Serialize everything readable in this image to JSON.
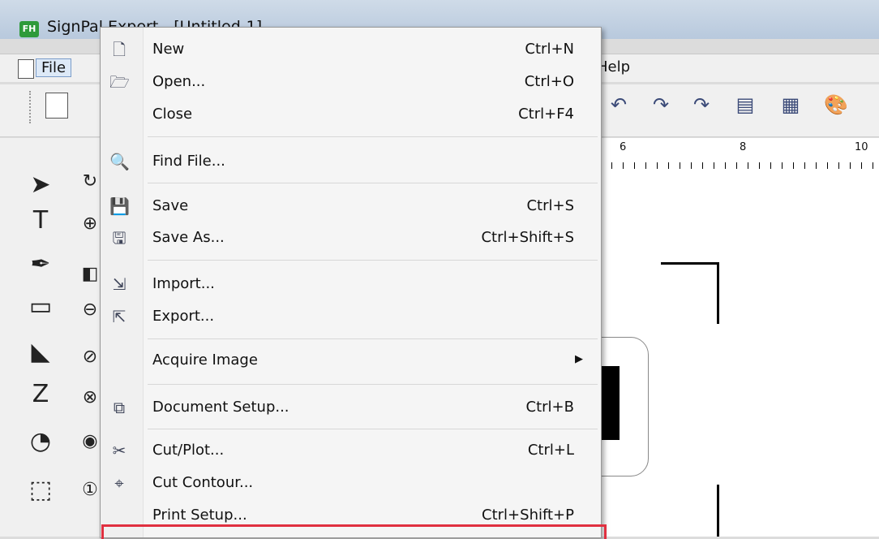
{
  "app": {
    "title": "SignPal Expert - [Untitled-1]",
    "app_icon_text": "FH"
  },
  "menubar": {
    "file_label": "File",
    "help_label": "Help"
  },
  "ruler": {
    "labels": [
      "6",
      "8",
      "10"
    ]
  },
  "file_menu": {
    "items": [
      {
        "label": "New",
        "shortcut": "Ctrl+N",
        "icon": "new-document-icon"
      },
      {
        "label": "Open...",
        "shortcut": "Ctrl+O",
        "icon": "open-icon"
      },
      {
        "label": "Close",
        "shortcut": "Ctrl+F4",
        "icon": ""
      },
      {
        "label": "Find File...",
        "shortcut": "",
        "icon": "find-file-icon"
      },
      {
        "label": "Save",
        "shortcut": "Ctrl+S",
        "icon": "save-icon"
      },
      {
        "label": "Save As...",
        "shortcut": "Ctrl+Shift+S",
        "icon": "save-as-icon"
      },
      {
        "label": "Import...",
        "shortcut": "",
        "icon": "import-icon"
      },
      {
        "label": "Export...",
        "shortcut": "",
        "icon": "export-icon"
      },
      {
        "label": "Acquire Image",
        "shortcut": "",
        "icon": "",
        "submenu": true
      },
      {
        "label": "Document Setup...",
        "shortcut": "Ctrl+B",
        "icon": "document-setup-icon"
      },
      {
        "label": "Cut/Plot...",
        "shortcut": "Ctrl+L",
        "icon": "cut-plot-icon"
      },
      {
        "label": "Cut Contour...",
        "shortcut": "",
        "icon": "cut-contour-icon"
      },
      {
        "label": "Print Setup...",
        "shortcut": "Ctrl+Shift+P",
        "icon": ""
      }
    ]
  },
  "colors": {
    "highlight": "#e03040",
    "menu_bg": "#f5f5f5"
  }
}
